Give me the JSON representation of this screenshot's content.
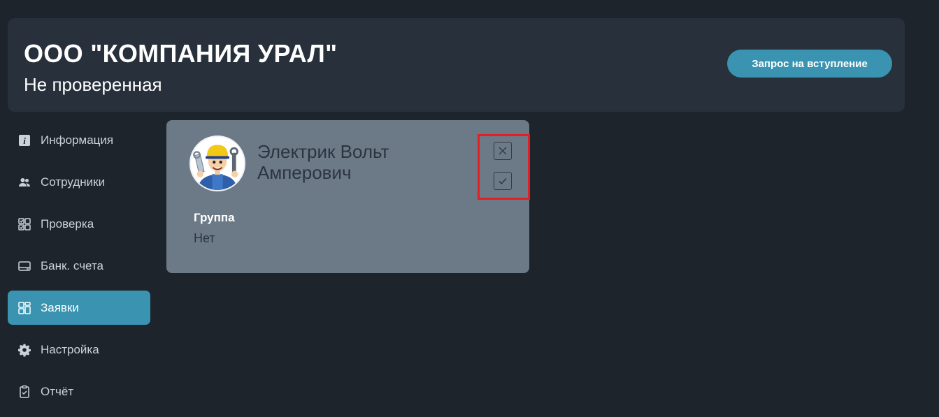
{
  "header": {
    "company_name": "ООО \"КОМПАНИЯ УРАЛ\"",
    "status": "Не проверенная",
    "join_request_label": "Запрос на вступление"
  },
  "sidebar": {
    "items": [
      {
        "label": "Информация",
        "icon": "info-icon",
        "active": false
      },
      {
        "label": "Сотрудники",
        "icon": "people-icon",
        "active": false
      },
      {
        "label": "Проверка",
        "icon": "checklist-icon",
        "active": false
      },
      {
        "label": "Банк. счета",
        "icon": "card-icon",
        "active": false
      },
      {
        "label": "Заявки",
        "icon": "grid-icon",
        "active": true
      },
      {
        "label": "Настройка",
        "icon": "gear-icon",
        "active": false
      },
      {
        "label": "Отчёт",
        "icon": "clipboard-check-icon",
        "active": false
      }
    ]
  },
  "request_card": {
    "name": "Электрик Вольт Амперович",
    "group_label": "Группа",
    "group_value": "Нет",
    "avatar_icon": "electrician-avatar",
    "reject_icon": "close-icon",
    "approve_icon": "check-icon"
  },
  "colors": {
    "background": "#1d242c",
    "panel": "#27303b",
    "accent": "#3a93b1",
    "card": "#6c7a87",
    "highlight": "#e31e24"
  }
}
